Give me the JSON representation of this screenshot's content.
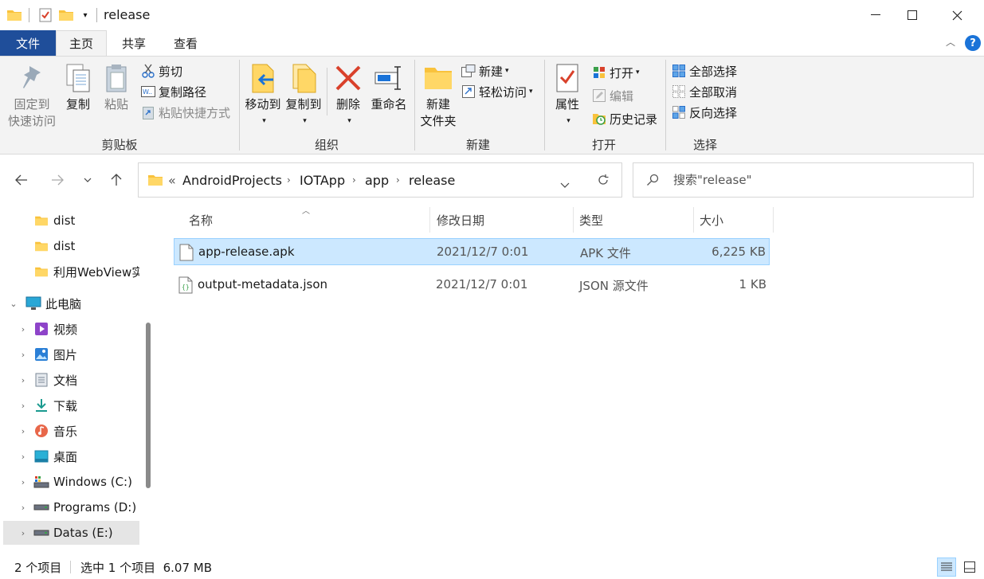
{
  "window": {
    "title": "release",
    "colors": {
      "accent": "#1f4e9a",
      "selection": "#cce8ff",
      "folder": "#f9c23c"
    }
  },
  "tabs": [
    {
      "label": "文件"
    },
    {
      "label": "主页"
    },
    {
      "label": "共享"
    },
    {
      "label": "查看"
    }
  ],
  "ribbon": {
    "clipboard": {
      "label": "剪贴板",
      "pin": "固定到\n快速访问",
      "copy": "复制",
      "paste": "粘贴",
      "cut": "剪切",
      "copy_path": "复制路径",
      "paste_shortcut": "粘贴快捷方式"
    },
    "organize": {
      "label": "组织",
      "move_to": "移动到",
      "copy_to": "复制到",
      "delete": "删除",
      "rename": "重命名"
    },
    "new": {
      "label": "新建",
      "new_folder": "新建\n文件夹",
      "new_item": "新建",
      "easy_access": "轻松访问"
    },
    "open": {
      "label": "打开",
      "properties": "属性",
      "open": "打开",
      "edit": "编辑",
      "history": "历史记录"
    },
    "select": {
      "label": "选择",
      "select_all": "全部选择",
      "select_none": "全部取消",
      "invert": "反向选择"
    }
  },
  "address": {
    "overflow": "«",
    "crumbs": [
      "AndroidProjects",
      "IOTApp",
      "app",
      "release"
    ],
    "search_placeholder": "搜索\"release\""
  },
  "nav_tree": [
    {
      "label": "dist",
      "icon": "folder-icon"
    },
    {
      "label": "dist",
      "icon": "folder-icon"
    },
    {
      "label": "利用WebView实",
      "icon": "folder-icon"
    },
    {
      "label": "此电脑",
      "icon": "computer-icon"
    },
    {
      "label": "视频",
      "icon": "video-icon"
    },
    {
      "label": "图片",
      "icon": "pictures-icon"
    },
    {
      "label": "文档",
      "icon": "documents-icon"
    },
    {
      "label": "下载",
      "icon": "download-icon"
    },
    {
      "label": "音乐",
      "icon": "music-icon"
    },
    {
      "label": "桌面",
      "icon": "desktop-icon"
    },
    {
      "label": "Windows (C:)",
      "icon": "system-drive-icon"
    },
    {
      "label": "Programs (D:)",
      "icon": "drive-icon"
    },
    {
      "label": "Datas (E:)",
      "icon": "drive-icon"
    }
  ],
  "file_list": {
    "columns": [
      "名称",
      "修改日期",
      "类型",
      "大小"
    ],
    "rows": [
      {
        "name": "app-release.apk",
        "modified": "2021/12/7 0:01",
        "type": "APK 文件",
        "size": "6,225 KB",
        "icon": "file-icon"
      },
      {
        "name": "output-metadata.json",
        "modified": "2021/12/7 0:01",
        "type": "JSON 源文件",
        "size": "1 KB",
        "icon": "json-file-icon"
      }
    ]
  },
  "status": {
    "item_count": "2 个项目",
    "selection": "选中 1 个项目  6.07 MB"
  }
}
